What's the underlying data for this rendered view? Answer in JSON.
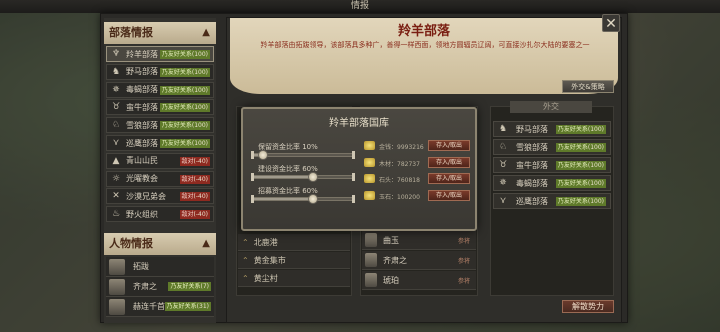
{
  "window": {
    "title": "情报"
  },
  "tribes_section": {
    "title": "部落情报"
  },
  "tribes": [
    {
      "name": "羚羊部落",
      "icon": "antelope-icon",
      "star": "★",
      "status": "乃友好关系",
      "value": "(100)",
      "status_color": "green",
      "selected": true
    },
    {
      "name": "野马部落",
      "icon": "horse-icon",
      "star": "",
      "status": "乃友好关系",
      "value": "(100)",
      "status_color": "green",
      "selected": false
    },
    {
      "name": "毒蝎部落",
      "icon": "scorpion-icon",
      "star": "",
      "status": "乃友好关系",
      "value": "(100)",
      "status_color": "green",
      "selected": false
    },
    {
      "name": "蛮牛部落",
      "icon": "bull-icon",
      "star": "",
      "status": "乃友好关系",
      "value": "(100)",
      "status_color": "green",
      "selected": false
    },
    {
      "name": "雪狼部落",
      "icon": "wolf-icon",
      "star": "",
      "status": "乃友好关系",
      "value": "(100)",
      "status_color": "green",
      "selected": false
    },
    {
      "name": "巡鹰部落",
      "icon": "eagle-icon",
      "star": "",
      "status": "乃友好关系",
      "value": "(100)",
      "status_color": "green",
      "selected": false
    },
    {
      "name": "青山山民",
      "icon": "mountain-icon",
      "star": "",
      "status": "敌对",
      "value": "(-40)",
      "status_color": "red",
      "selected": false
    },
    {
      "name": "光曜教会",
      "icon": "sun-icon",
      "star": "",
      "status": "敌对",
      "value": "(-40)",
      "status_color": "red",
      "selected": false
    },
    {
      "name": "沙漠兄弟会",
      "icon": "swords-icon",
      "star": "",
      "status": "敌对",
      "value": "(-40)",
      "status_color": "red",
      "selected": false
    },
    {
      "name": "野火组织",
      "icon": "fire-icon",
      "star": "",
      "status": "敌对",
      "value": "(-40)",
      "status_color": "red",
      "selected": false
    }
  ],
  "people_section": {
    "title": "人物情报"
  },
  "people": [
    {
      "name": "拓跋",
      "status": "",
      "value": "",
      "status_color": ""
    },
    {
      "name": "齐肃之",
      "status": "乃友好关系",
      "value": "(7)",
      "status_color": "green"
    },
    {
      "name": "赫连千首",
      "status": "乃友好关系",
      "value": "(31)",
      "status_color": "green"
    }
  ],
  "detail": {
    "title": "羚羊部落",
    "description": "羚羊部落由拓跋领导，该部落具多种广，善得一样西面，领地方圆辐员辽阔，可直接沙扎尔大陆的要塞之一",
    "diplomacy_button": "外交&策略",
    "dismiss_button": "解散势力",
    "diplomacy_tab": "外交"
  },
  "treasury": {
    "title": "羚羊部落国库",
    "sliders": [
      {
        "label": "保留资金比率 10%",
        "value": 0.1
      },
      {
        "label": "建设资金比率 60%",
        "value": 0.6
      },
      {
        "label": "招募资金比率 60%",
        "value": 0.6
      }
    ],
    "resources": [
      {
        "text": "金钱：9993216",
        "icon": "gold-coins-icon",
        "button": "存入/取出"
      },
      {
        "text": "木材：782737",
        "icon": "wood-icon",
        "button": "存入/取出"
      },
      {
        "text": "石头：760818",
        "icon": "stone-icon",
        "button": "存入/取出"
      },
      {
        "text": "玉石：100200",
        "icon": "jade-icon",
        "button": "存入/取出"
      }
    ]
  },
  "locations": [
    {
      "name": "北鹿港"
    },
    {
      "name": "黄金集市"
    },
    {
      "name": "黄尘村"
    }
  ],
  "characters": [
    {
      "name": "曲玉",
      "tag": "参将"
    },
    {
      "name": "齐肃之",
      "tag": "参将"
    },
    {
      "name": "琥珀",
      "tag": "参将"
    }
  ],
  "allies": [
    {
      "name": "野马部落",
      "icon": "horse-icon",
      "status": "乃友好关系",
      "value": "(100)"
    },
    {
      "name": "雪狼部落",
      "icon": "wolf-icon",
      "status": "乃友好关系",
      "value": "(100)"
    },
    {
      "name": "蛮牛部落",
      "icon": "bull-icon",
      "status": "乃友好关系",
      "value": "(100)"
    },
    {
      "name": "毒蝎部落",
      "icon": "scorpion-icon",
      "status": "乃友好关系",
      "value": "(100)"
    },
    {
      "name": "巡鹰部落",
      "icon": "eagle-icon",
      "status": "乃友好关系",
      "value": "(100)"
    }
  ],
  "colors": {
    "accent_red": "#7a1f12",
    "friendly_green": "#5f7a2a",
    "hostile_red": "#8e2a20"
  }
}
